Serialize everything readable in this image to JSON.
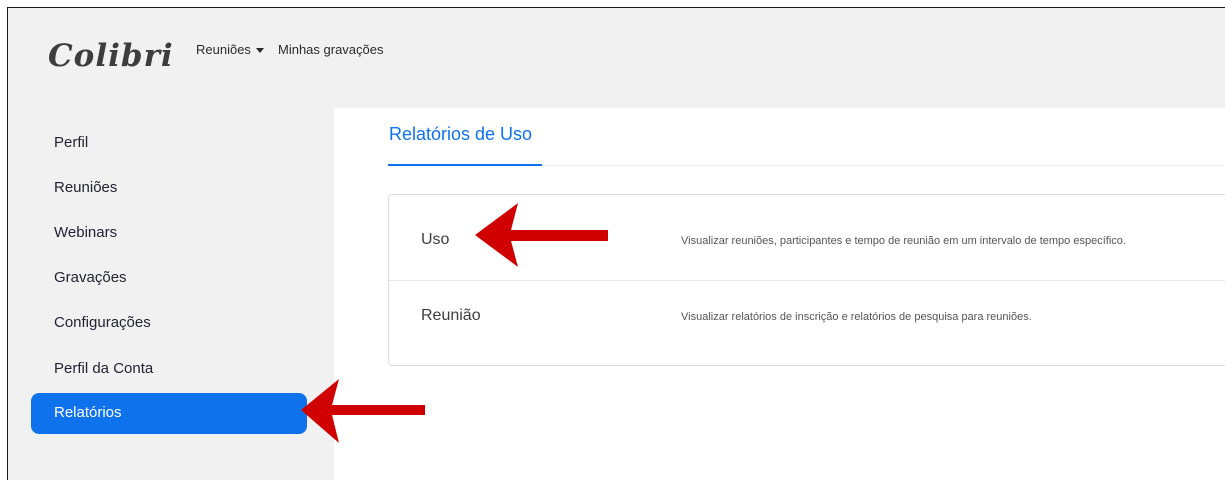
{
  "header": {
    "logo": "Colibri",
    "nav": [
      {
        "label": "Reuniões",
        "has_dropdown": true
      },
      {
        "label": "Minhas gravações",
        "has_dropdown": false
      }
    ]
  },
  "sidebar": {
    "items": [
      {
        "label": "Perfil"
      },
      {
        "label": "Reuniões"
      },
      {
        "label": "Webinars"
      },
      {
        "label": "Gravações"
      },
      {
        "label": "Configurações"
      },
      {
        "label": "Perfil da Conta"
      },
      {
        "label": "Relatórios",
        "active": true
      }
    ]
  },
  "main": {
    "title": "Relatórios de Uso",
    "reports": [
      {
        "name": "Uso",
        "description": "Visualizar reuniões, participantes e tempo de reunião em um intervalo de tempo específico."
      },
      {
        "name": "Reunião",
        "description": "Visualizar relatórios de inscrição e relatórios de pesquisa para reuniões."
      }
    ]
  },
  "annotations": {
    "arrow_color": "#d10000",
    "arrows": [
      "points-to-uso",
      "points-to-relatorios"
    ]
  },
  "colors": {
    "accent": "#0e72ed",
    "chrome": "#f1f1f1"
  }
}
